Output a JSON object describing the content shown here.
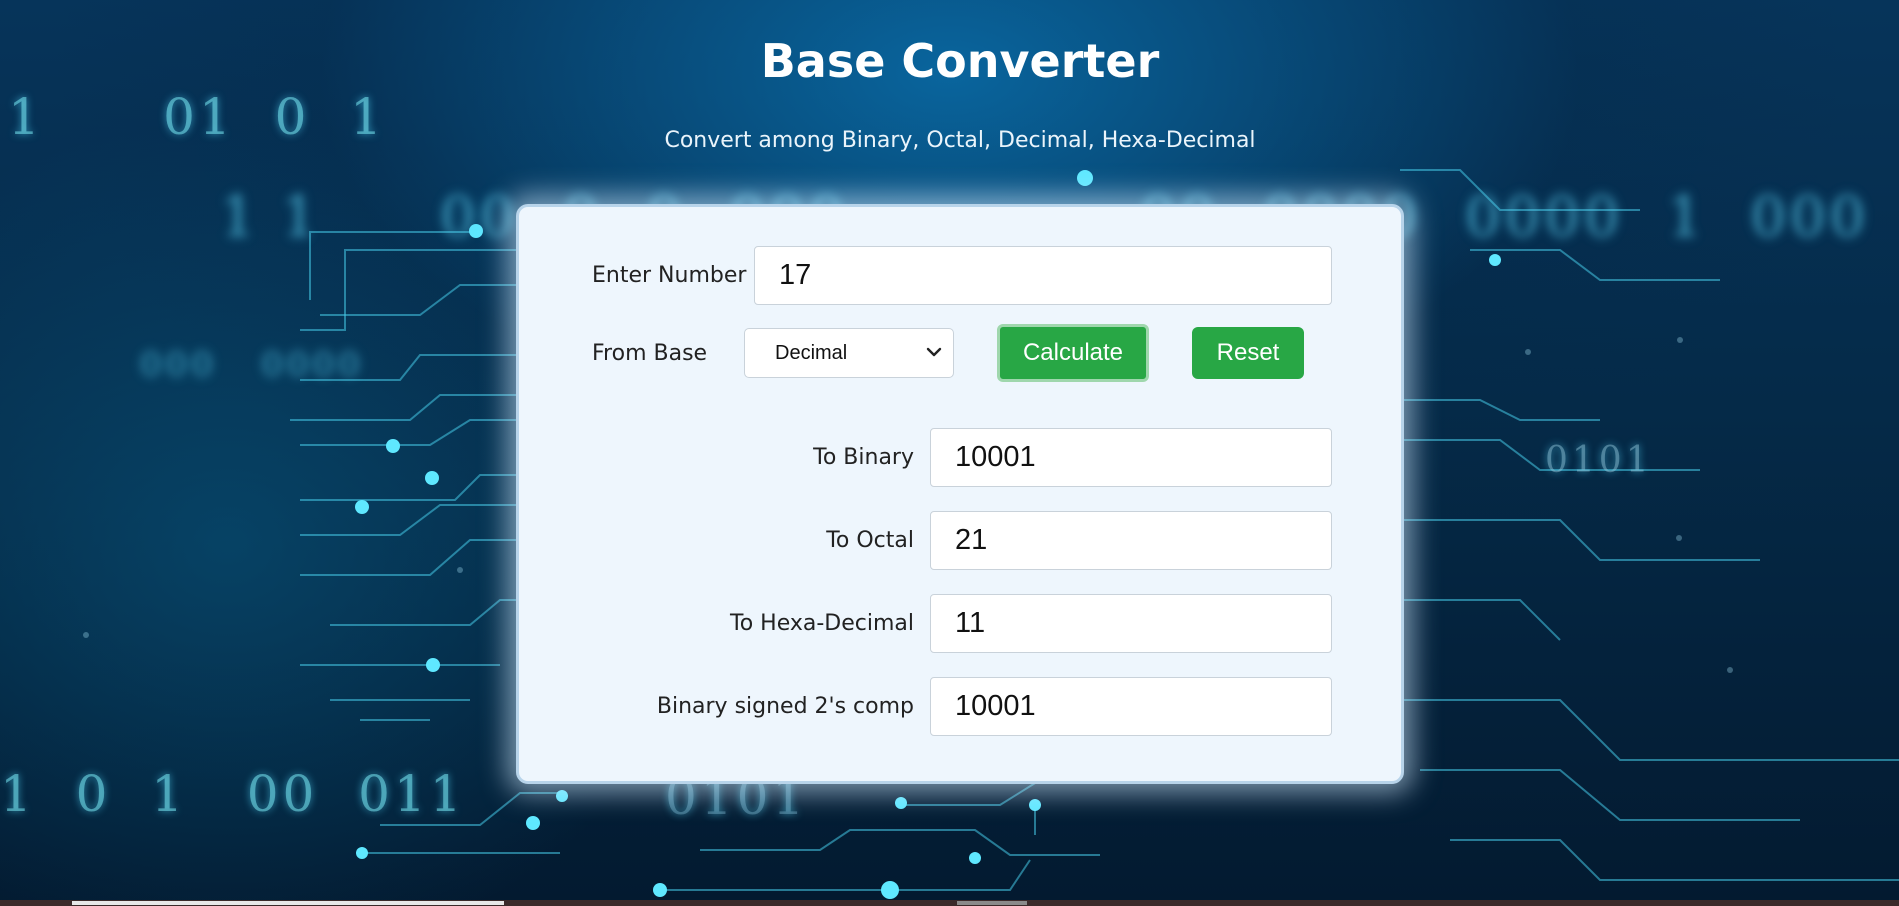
{
  "page": {
    "title": "Base Converter",
    "subtitle": "Convert among Binary, Octal, Decimal, Hexa-Decimal"
  },
  "background": {
    "digits_top_left": "1      01  0  1",
    "digits_bottom_left": "1  0  1   00  011",
    "digits_bottom_mid": "0101",
    "digits_right": "0101"
  },
  "form": {
    "enter_number_label": "Enter Number",
    "enter_number_value": "17",
    "from_base_label": "From Base",
    "from_base_selected": "Decimal",
    "calculate_label": "Calculate",
    "reset_label": "Reset"
  },
  "results": {
    "binary_label": "To Binary",
    "binary_value": "10001",
    "octal_label": "To Octal",
    "octal_value": "21",
    "hex_label": "To Hexa-Decimal",
    "hex_value": "11",
    "twos_label": "Binary signed 2's comp",
    "twos_value": "10001"
  },
  "colors": {
    "button_green": "#28a745",
    "card_bg": "#eef6fd"
  },
  "icons": {
    "select_arrow": "chevron-down-icon"
  }
}
